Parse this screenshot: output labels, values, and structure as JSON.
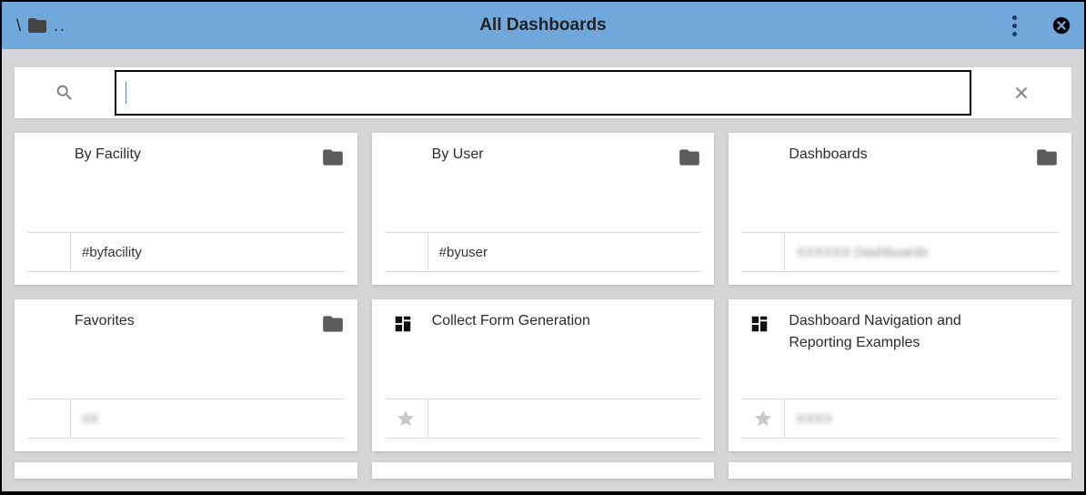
{
  "header": {
    "breadcrumb_root": "\\",
    "breadcrumb_dots": "..",
    "title": "All Dashboards"
  },
  "search": {
    "value": "",
    "placeholder": ""
  },
  "cards": [
    {
      "type": "folder",
      "title": "By Facility",
      "meta": "#byfacility",
      "meta_blur": false,
      "star": false
    },
    {
      "type": "folder",
      "title": "By User",
      "meta": "#byuser",
      "meta_blur": false,
      "star": false
    },
    {
      "type": "folder",
      "title": "Dashboards",
      "meta": "XXXXXX Dashboards",
      "meta_blur": true,
      "star": false
    },
    {
      "type": "folder",
      "title": "Favorites",
      "meta": "#X",
      "meta_blur": true,
      "star": false
    },
    {
      "type": "dashboard",
      "title": "Collect Form Generation",
      "meta": "",
      "meta_blur": false,
      "star": true
    },
    {
      "type": "dashboard",
      "title": "Dashboard Navigation and Reporting Examples",
      "meta": "XXXX",
      "meta_blur": true,
      "star": true
    }
  ]
}
